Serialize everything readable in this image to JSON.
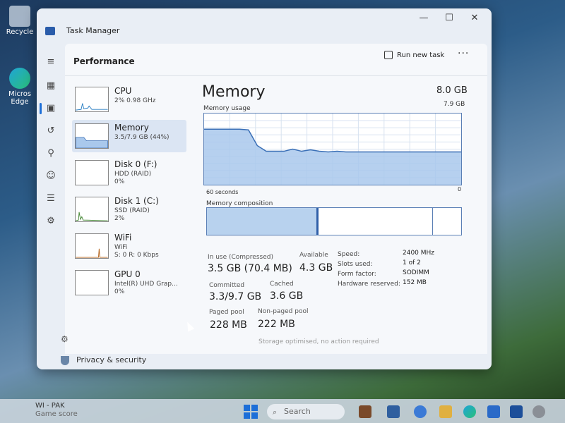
{
  "desktop": {
    "icons": [
      {
        "label": "Recycle",
        "name": "recycle-bin-icon"
      },
      {
        "label": "Micros Edge",
        "name": "edge-icon"
      }
    ]
  },
  "window": {
    "title": "Task Manager",
    "controls": {
      "minimize": "—",
      "maximize": "☐",
      "close": "✕"
    }
  },
  "header": {
    "title": "Performance",
    "run_task_label": "Run new task",
    "more_label": "···"
  },
  "perf_list": [
    {
      "name": "CPU",
      "sub1": "2% 0.98 GHz",
      "sub2": ""
    },
    {
      "name": "Memory",
      "sub1": "3.5/7.9 GB (44%)",
      "sub2": ""
    },
    {
      "name": "Disk 0 (F:)",
      "sub1": "HDD (RAID)",
      "sub2": "0%"
    },
    {
      "name": "Disk 1 (C:)",
      "sub1": "SSD (RAID)",
      "sub2": "2%"
    },
    {
      "name": "WiFi",
      "sub1": "WiFi",
      "sub2": "S: 0 R: 0 Kbps"
    },
    {
      "name": "GPU 0",
      "sub1": "Intel(R) UHD Grap...",
      "sub2": "0%"
    }
  ],
  "memory": {
    "title": "Memory",
    "total": "8.0 GB",
    "usage_label": "Memory usage",
    "usage_max": "7.9 GB",
    "axis_left": "60 seconds",
    "axis_right": "0",
    "composition_label": "Memory composition",
    "usage_series": [
      0.78,
      0.78,
      0.78,
      0.78,
      0.78,
      0.77,
      0.55,
      0.47,
      0.47,
      0.47,
      0.5,
      0.47,
      0.49,
      0.47,
      0.46,
      0.47,
      0.46,
      0.46,
      0.46,
      0.46,
      0.46,
      0.46,
      0.46,
      0.46,
      0.46,
      0.46,
      0.46,
      0.46,
      0.46,
      0.46
    ],
    "composition": [
      0.44,
      0.45,
      0.11
    ],
    "stats": {
      "in_use_label": "In use (Compressed)",
      "in_use_value": "3.5 GB (70.4 MB)",
      "available_label": "Available",
      "available_value": "4.3 GB",
      "committed_label": "Committed",
      "committed_value": "3.3/9.7 GB",
      "cached_label": "Cached",
      "cached_value": "3.6 GB",
      "paged_label": "Paged pool",
      "paged_value": "228 MB",
      "nonpaged_label": "Non-paged pool",
      "nonpaged_value": "222 MB"
    },
    "specs": [
      {
        "label": "Speed:",
        "value": "2400 MHz"
      },
      {
        "label": "Slots used:",
        "value": "1 of 2"
      },
      {
        "label": "Form factor:",
        "value": "SODIMM"
      },
      {
        "label": "Hardware reserved:",
        "value": "152 MB"
      }
    ]
  },
  "footer": {
    "privacy_label": "Privacy & security",
    "faded_text": "Storage optimised, no action required"
  },
  "taskbar": {
    "weather_title": "WI - PAK",
    "weather_sub": "Game score",
    "search_placeholder": "Search"
  },
  "colors": {
    "accent": "#1d6fd8",
    "graph_fill": "#a9c8ec",
    "graph_line": "#3a6fb6"
  }
}
